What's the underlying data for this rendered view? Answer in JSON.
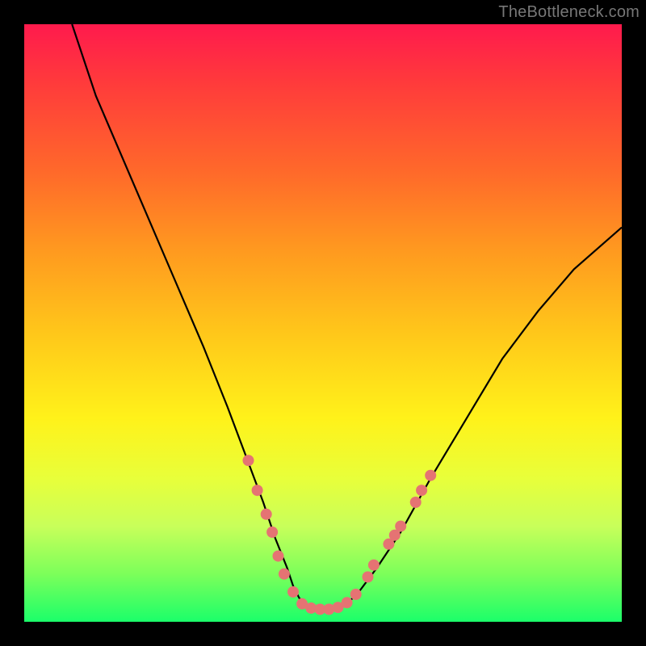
{
  "watermark": "TheBottleneck.com",
  "chart_data": {
    "type": "line",
    "title": "",
    "xlabel": "",
    "ylabel": "",
    "xlim": [
      0,
      100
    ],
    "ylim": [
      0,
      100
    ],
    "series": [
      {
        "name": "curve",
        "x": [
          8,
          12,
          18,
          24,
          30,
          34,
          37,
          40,
          42,
          44,
          45,
          46,
          47,
          48,
          50,
          52,
          54,
          56,
          59,
          63,
          68,
          74,
          80,
          86,
          92,
          100
        ],
        "values": [
          100,
          88,
          74,
          60,
          46,
          36,
          28,
          20,
          14,
          9,
          6,
          4,
          3,
          2,
          2,
          2,
          3,
          5,
          9,
          15,
          24,
          34,
          44,
          52,
          59,
          66
        ]
      }
    ],
    "markers": {
      "color": "#e57373",
      "radius": 7,
      "points": [
        {
          "x": 37.5,
          "y": 27
        },
        {
          "x": 39.0,
          "y": 22
        },
        {
          "x": 40.5,
          "y": 18
        },
        {
          "x": 41.5,
          "y": 15
        },
        {
          "x": 42.5,
          "y": 11
        },
        {
          "x": 43.5,
          "y": 8
        },
        {
          "x": 45.0,
          "y": 5
        },
        {
          "x": 46.5,
          "y": 3
        },
        {
          "x": 48.0,
          "y": 2.3
        },
        {
          "x": 49.5,
          "y": 2.1
        },
        {
          "x": 51.0,
          "y": 2.1
        },
        {
          "x": 52.5,
          "y": 2.4
        },
        {
          "x": 54.0,
          "y": 3.2
        },
        {
          "x": 55.5,
          "y": 4.6
        },
        {
          "x": 57.5,
          "y": 7.5
        },
        {
          "x": 58.5,
          "y": 9.5
        },
        {
          "x": 61.0,
          "y": 13
        },
        {
          "x": 62.0,
          "y": 14.5
        },
        {
          "x": 63.0,
          "y": 16
        },
        {
          "x": 65.5,
          "y": 20
        },
        {
          "x": 66.5,
          "y": 22
        },
        {
          "x": 68.0,
          "y": 24.5
        }
      ]
    },
    "background_gradient": {
      "top": "#ff1a4d",
      "bottom": "#1bff6a"
    },
    "frame_color": "#000000",
    "curve_color": "#000000"
  }
}
